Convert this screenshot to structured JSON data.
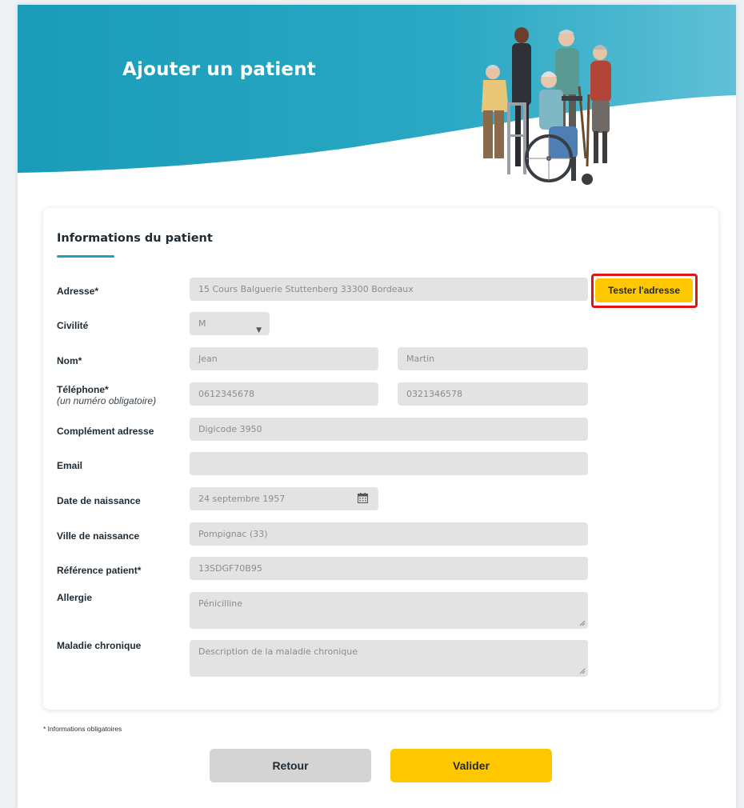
{
  "header": {
    "title": "Ajouter un patient",
    "accent_color": "#2aa8c4"
  },
  "form": {
    "section_title": "Informations du patient",
    "address": {
      "label": "Adresse*",
      "value": "15 Cours Balguerie Stuttenberg 33300 Bordeaux",
      "test_button": "Tester l'adresse"
    },
    "civility": {
      "label": "Civilité",
      "value": "M"
    },
    "name": {
      "label": "Nom*",
      "first": "Jean",
      "last": "Martin"
    },
    "phone": {
      "label": "Téléphone*",
      "sublabel": "(un numéro obligatoire)",
      "primary": "0612345678",
      "secondary": "0321346578"
    },
    "address_complement": {
      "label": "Complément adresse",
      "value": "Digicode 3950"
    },
    "email": {
      "label": "Email",
      "value": ""
    },
    "birth_date": {
      "label": "Date de naissance",
      "value": "24 septembre 1957"
    },
    "birth_city": {
      "label": "Ville de naissance",
      "value": "Pompignac (33)"
    },
    "patient_ref": {
      "label": "Référence patient*",
      "value": "13SDGF70B95"
    },
    "allergy": {
      "label": "Allergie",
      "value": "Pénicilline"
    },
    "chronic_disease": {
      "label": "Maladie chronique",
      "placeholder": "Description de la maladie chronique"
    }
  },
  "footnote": "* Informations obligatoires",
  "actions": {
    "back": "Retour",
    "submit": "Valider"
  },
  "colors": {
    "yellow": "#ffc700",
    "highlight": "#e1141a",
    "field": "#e3e3e3"
  }
}
